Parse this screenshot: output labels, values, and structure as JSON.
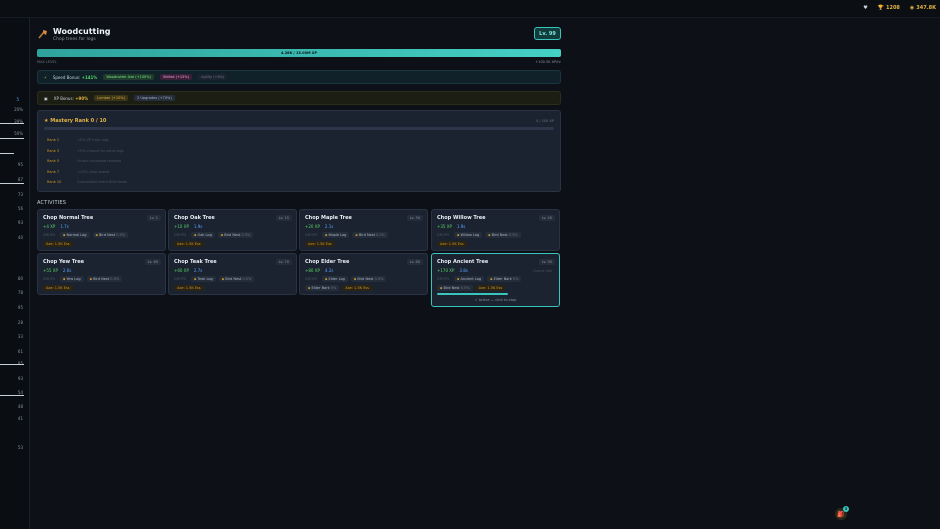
{
  "topbar": {
    "stats": [
      {
        "icon": "heart-icon",
        "value": "",
        "color": "#c9d1d9"
      },
      {
        "icon": "trophy-icon",
        "value": "1208",
        "color": "#e3b341"
      },
      {
        "icon": "coin-icon",
        "value": "347.8K",
        "color": "#e3b341"
      }
    ]
  },
  "sidebar": {
    "values": [
      "5",
      "20%",
      "39%",
      "50%",
      "95",
      "87",
      "73",
      "56",
      "93",
      "40",
      "80",
      "78",
      "95",
      "28",
      "33",
      "61",
      "85",
      "93",
      "54",
      "48",
      "41",
      "53"
    ]
  },
  "skill": {
    "title": "Woodcutting",
    "subtitle": "Chop trees for logs",
    "level": "Lv. 99",
    "xp_text": "4.28K / 13.03M XP",
    "xp_progress": 1.0,
    "xp_left": "MAX LEVEL",
    "xp_right": "+100.5K XP/hr"
  },
  "bonuses": {
    "speed_label": "Speed Bonus:",
    "speed_value": "+141%",
    "speed_chips": [
      "Woodcutter Axe (+100%)",
      "Skilled (+15%)",
      "Agility (+6%)"
    ],
    "xp_label": "XP Bonus:",
    "xp_value": "+90%",
    "xp_chips": [
      "Lumber (+10%)",
      "2 Upgrades (+70%)"
    ]
  },
  "mastery": {
    "title": "Mastery Rank 0 / 10",
    "right": "0 / 100 XP",
    "ranks": [
      {
        "rank": "Rank 1",
        "desc": "+5% XP from logs"
      },
      {
        "rank": "Rank 3",
        "desc": "+5% chance for extra logs"
      },
      {
        "rank": "Rank 5",
        "desc": "Unlock Ironwood rewards"
      },
      {
        "rank": "Rank 7",
        "desc": "+10% chop speed"
      },
      {
        "rank": "Rank 10",
        "desc": "Guaranteed extra Bird Nests"
      }
    ]
  },
  "activities": {
    "header": "ACTIVITIES",
    "items": [
      {
        "name": "Chop Normal Tree",
        "level": "Lv. 1",
        "xp": "+4 XP",
        "time": "1.7s",
        "drops": [
          {
            "name": "Normal Log",
            "q": ""
          },
          {
            "name": "Bird Nest",
            "q": "0.5%"
          }
        ],
        "cost": "Axe: 1.5K Ess"
      },
      {
        "name": "Chop Oak Tree",
        "level": "Lv. 15",
        "xp": "+10 XP",
        "time": "1.9s",
        "drops": [
          {
            "name": "Oak Log",
            "q": ""
          },
          {
            "name": "Bird Nest",
            "q": "0.5%"
          }
        ],
        "cost": "Axe: 1.5K Ess"
      },
      {
        "name": "Chop Maple Tree",
        "level": "Lv. 30",
        "xp": "+20 XP",
        "time": "2.1s",
        "drops": [
          {
            "name": "Maple Log",
            "q": ""
          },
          {
            "name": "Bird Nest",
            "q": "0.5%"
          }
        ],
        "cost": "Axe: 1.5K Ess"
      },
      {
        "name": "Chop Willow Tree",
        "level": "Lv. 45",
        "xp": "+35 XP",
        "time": "1.9s",
        "drops": [
          {
            "name": "Willow Log",
            "q": ""
          },
          {
            "name": "Bird Nest",
            "q": "0.5%"
          }
        ],
        "cost": "Axe: 1.5K Ess"
      },
      {
        "name": "Chop Yew Tree",
        "level": "Lv. 60",
        "xp": "+55 XP",
        "time": "2.6s",
        "drops": [
          {
            "name": "Yew Log",
            "q": ""
          },
          {
            "name": "Bird Nest",
            "q": "0.5%"
          }
        ],
        "cost": "Axe: 1.5K Ess"
      },
      {
        "name": "Chop Teak Tree",
        "level": "Lv. 70",
        "xp": "+60 XP",
        "time": "2.7s",
        "drops": [
          {
            "name": "Teak Log",
            "q": ""
          },
          {
            "name": "Bird Nest",
            "q": "0.5%"
          }
        ],
        "cost": "Axe: 1.5K Ess"
      },
      {
        "name": "Chop Elder Tree",
        "level": "Lv. 80",
        "xp": "+80 XP",
        "time": "4.2s",
        "drops": [
          {
            "name": "Elder Log",
            "q": ""
          },
          {
            "name": "Bird Nest",
            "q": "0.5%"
          },
          {
            "name": "Elder Bark",
            "q": "5%"
          }
        ],
        "cost": "Axe: 1.5K Ess"
      },
      {
        "name": "Chop Ancient Tree",
        "level": "Lv. 90",
        "xp": "+170 XP",
        "time": "3.8s",
        "drops": [
          {
            "name": "Ancient Log",
            "q": ""
          },
          {
            "name": "Elder Bark",
            "q": "5%"
          },
          {
            "name": "Bird Nest",
            "q": "0.5%"
          }
        ],
        "cost": "Axe: 1.5K Ess",
        "active": true,
        "progress": 0.6,
        "active_text": "Active — click to stop",
        "queue_text": "Queue idle"
      }
    ],
    "drops_label": "DROPS"
  },
  "fab": {
    "icon": "bag-icon",
    "badge": "3"
  }
}
